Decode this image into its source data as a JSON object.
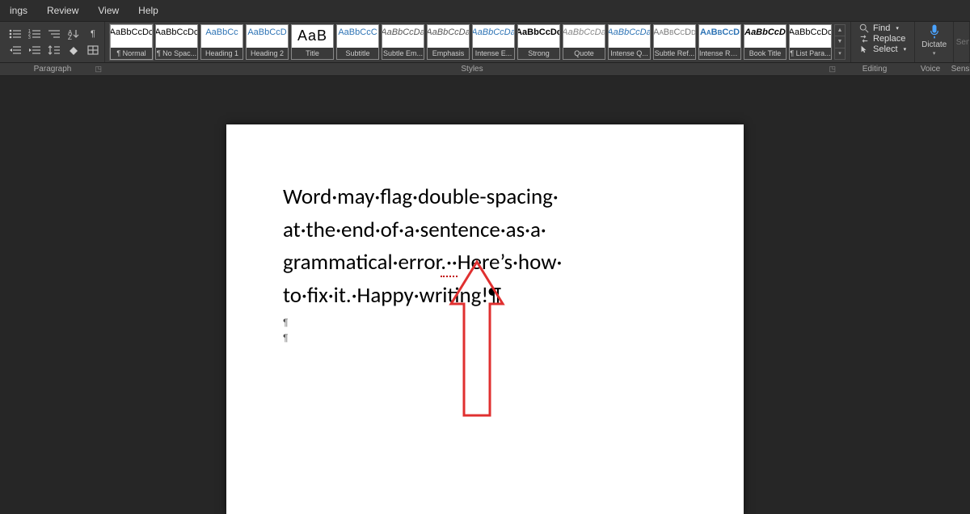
{
  "menu": {
    "items": [
      "ings",
      "Review",
      "View",
      "Help"
    ]
  },
  "groups": {
    "paragraph": {
      "label": "Paragraph"
    },
    "styles": {
      "label": "Styles"
    },
    "editing": {
      "label": "Editing",
      "find": "Find",
      "replace": "Replace",
      "select": "Select"
    },
    "voice": {
      "label": "Voice",
      "dictate": "Dictate"
    },
    "sens": {
      "label": "Sens",
      "btn": "Sen"
    }
  },
  "style_gallery": [
    {
      "preview": "AaBbCcDc",
      "label": "¶ Normal",
      "cls": "selected"
    },
    {
      "preview": "AaBbCcDc",
      "label": "¶ No Spac..."
    },
    {
      "preview": "AaBbCc",
      "label": "Heading 1",
      "cls": "heading"
    },
    {
      "preview": "AaBbCcD",
      "label": "Heading 2",
      "cls": "heading"
    },
    {
      "preview": "AaB",
      "label": "Title",
      "cls": "title"
    },
    {
      "preview": "AaBbCcC",
      "label": "Subtitle",
      "cls": "heading"
    },
    {
      "preview": "AaBbCcDa",
      "label": "Subtle Em...",
      "cls": "emph"
    },
    {
      "preview": "AaBbCcDa",
      "label": "Emphasis",
      "cls": "emph"
    },
    {
      "preview": "AaBbCcDa",
      "label": "Intense E...",
      "cls": "intenseE"
    },
    {
      "preview": "AaBbCcDc",
      "label": "Strong",
      "cls": "strong"
    },
    {
      "preview": "AaBbCcDa",
      "label": "Quote",
      "cls": "quote"
    },
    {
      "preview": "AaBbCcDa",
      "label": "Intense Q...",
      "cls": "intenseQ"
    },
    {
      "preview": "AaBbCcDd",
      "label": "Subtle Ref...",
      "cls": "subtleR"
    },
    {
      "preview": "AaBbCcD",
      "label": "Intense Re...",
      "cls": "intenseR"
    },
    {
      "preview": "AaBbCcD",
      "label": "Book Title",
      "cls": "bookT"
    },
    {
      "preview": "AaBbCcDc",
      "label": "¶ List Para..."
    }
  ],
  "document": {
    "line1": "Word·may·flag·double-spacing·",
    "line2": "at·the·end·of·a·sentence·as·a·",
    "line3a": "grammatical·error",
    "line3err": ".··",
    "line3b": "Here’s·how·",
    "line4": "to·fix·it.·Happy·writing!¶",
    "p2": "¶",
    "p3": "¶"
  }
}
